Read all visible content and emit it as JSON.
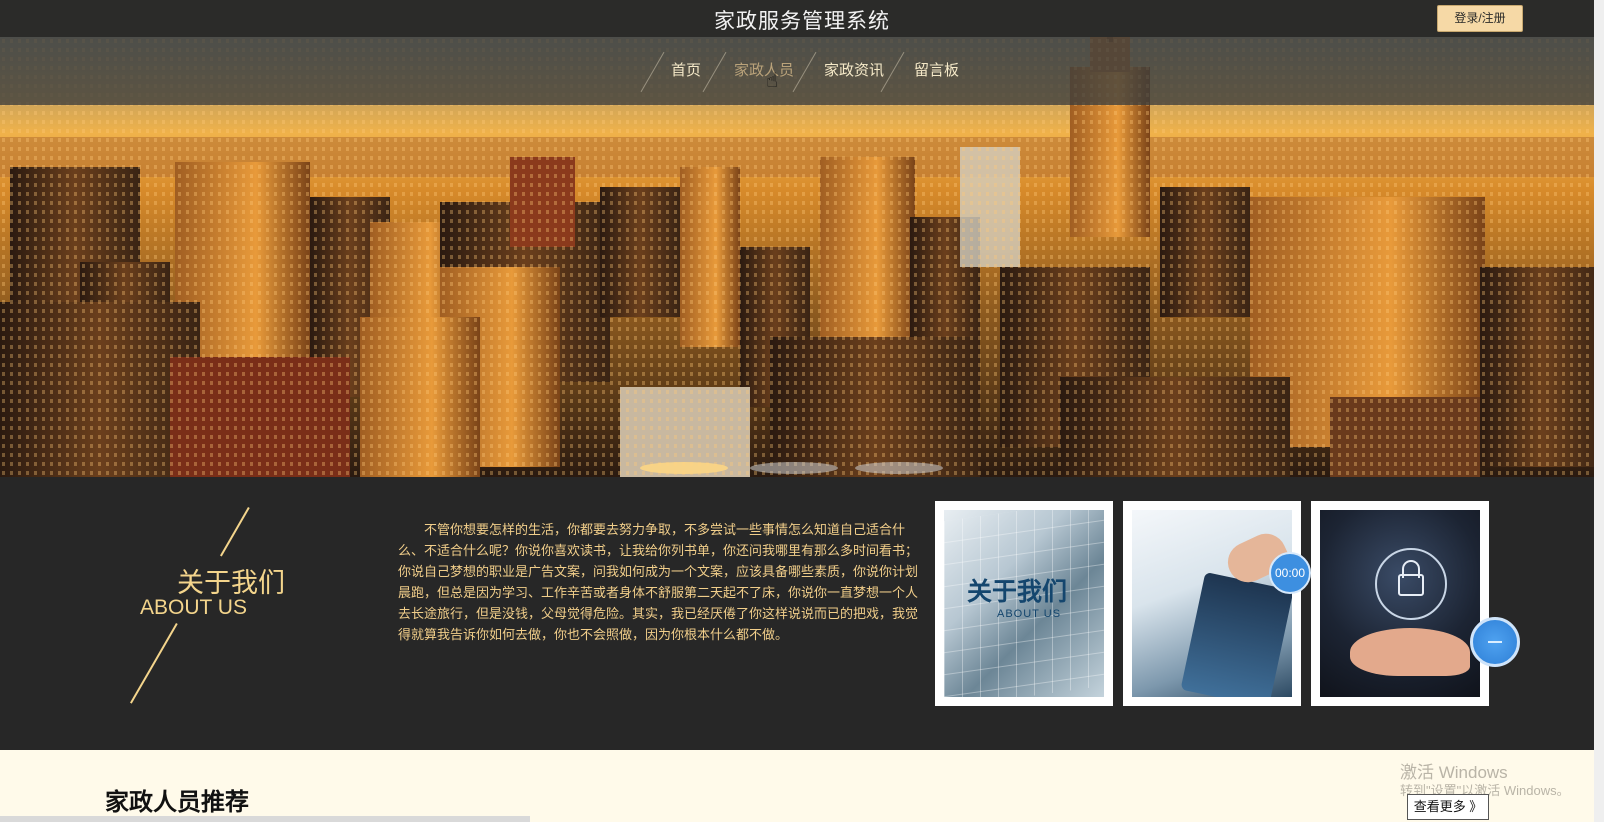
{
  "header": {
    "site_title": "家政服务管理系统",
    "login_label": "登录/注册"
  },
  "nav": {
    "items": [
      {
        "label": "首页"
      },
      {
        "label": "家政人员"
      },
      {
        "label": "家政资讯"
      },
      {
        "label": "留言板"
      }
    ],
    "active_index": 1
  },
  "banner": {
    "slide_count": 3,
    "active_slide": 0
  },
  "about": {
    "title_cn": "关于我们",
    "title_en": "ABOUT US",
    "text": "不管你想要怎样的生活，你都要去努力争取，不多尝试一些事情怎么知道自己适合什么、不适合什么呢？你说你喜欢读书，让我给你列书单，你还问我哪里有那么多时间看书；你说自己梦想的职业是广告文案，问我如何成为一个文案，应该具备哪些素质，你说你计划晨跑，但总是因为学习、工作辛苦或者身体不舒服第二天起不了床，你说你一直梦想一个人去长途旅行，但是没钱，父母觉得危险。其实，我已经厌倦了你这样说说而已的把戏，我觉得就算我告诉你如何去做，你也不会照做，因为你根本什么都不做。",
    "images": [
      {
        "caption_cn": "关于我们",
        "caption_en": "ABOUT US"
      },
      {
        "caption_cn": "",
        "caption_en": ""
      },
      {
        "caption_cn": "",
        "caption_en": ""
      }
    ],
    "timer": "00:00"
  },
  "recommend": {
    "title": "家政人员推荐",
    "more_label": "查看更多 》"
  },
  "os_watermark": {
    "line1": "激活 Windows",
    "line2": "转到\"设置\"以激活 Windows。"
  },
  "colors": {
    "topbar": "#2b2b29",
    "accent_gold": "#f4d58c",
    "about_bg": "#272727",
    "page_bg": "#fffaea"
  }
}
